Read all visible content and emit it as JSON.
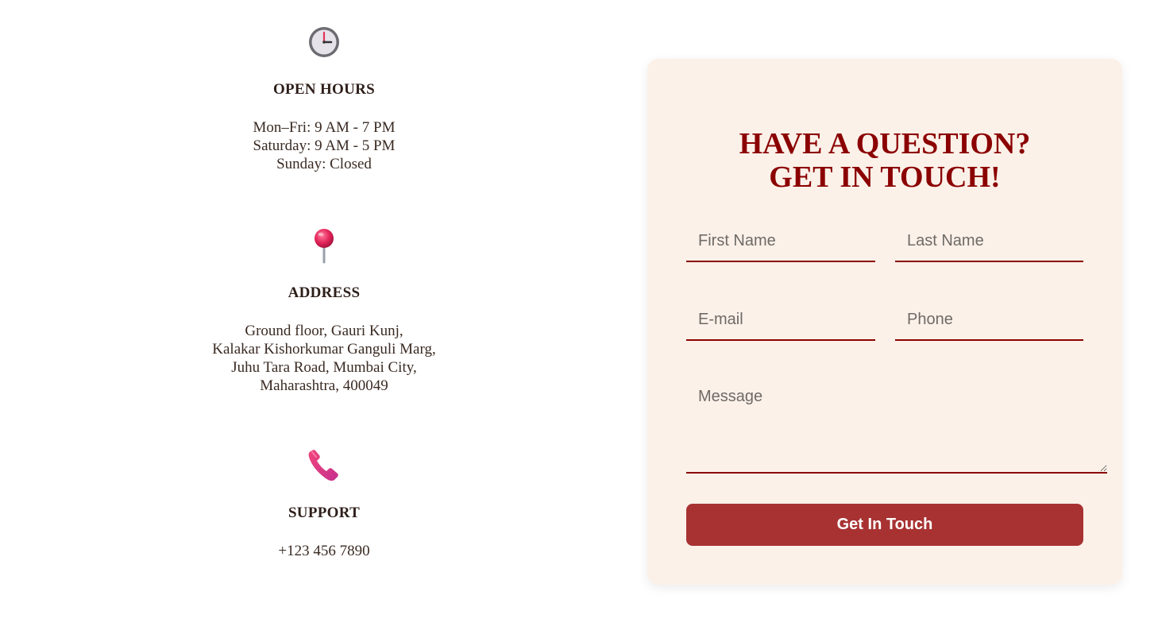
{
  "contact_info": {
    "hours": {
      "icon": "clock-icon",
      "title": "OPEN HOURS",
      "lines": [
        "Mon–Fri: 9 AM - 7 PM",
        "Saturday: 9 AM - 5 PM",
        "Sunday: Closed"
      ]
    },
    "address": {
      "icon": "map-pin-icon",
      "title": "ADDRESS",
      "lines": [
        "Ground floor, Gauri Kunj,",
        "Kalakar Kishorkumar Ganguli Marg,",
        "Juhu Tara Road, Mumbai City,",
        "Maharashtra, 400049"
      ]
    },
    "support": {
      "icon": "phone-icon",
      "title": "SUPPORT",
      "lines": [
        "+123 456 7890"
      ]
    }
  },
  "form": {
    "title_line1": "HAVE A QUESTION?",
    "title_line2": "GET IN TOUCH!",
    "first_name_placeholder": "First Name",
    "last_name_placeholder": "Last Name",
    "email_placeholder": "E-mail",
    "phone_placeholder": "Phone",
    "message_placeholder": "Message",
    "submit_label": "Get In Touch"
  },
  "colors": {
    "accent": "#8b0000",
    "button": "#a83232",
    "card_background": "#fbf1e9",
    "text": "#3a2a22"
  }
}
